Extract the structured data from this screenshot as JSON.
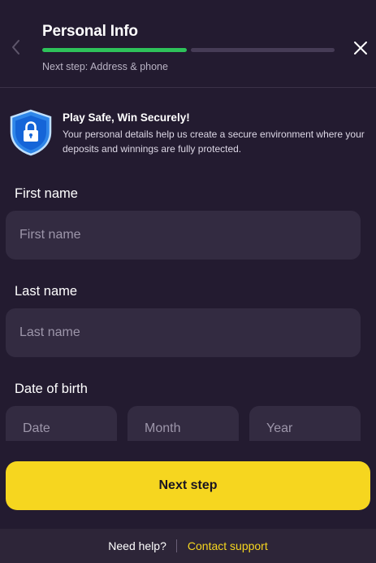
{
  "header": {
    "title": "Personal Info",
    "next_step_text": "Next step: Address & phone",
    "progress": {
      "steps_total": 2,
      "steps_completed": 1
    },
    "colors": {
      "progress_done": "#2ec25a",
      "progress_pending": "#463c56"
    }
  },
  "safety_notice": {
    "title": "Play Safe, Win Securely!",
    "description": "Your personal details help us create a secure environment where your deposits and winnings are fully protected.",
    "icon": "shield-lock-icon"
  },
  "form": {
    "first_name": {
      "label": "First name",
      "placeholder": "First name",
      "value": ""
    },
    "last_name": {
      "label": "Last name",
      "placeholder": "Last name",
      "value": ""
    },
    "dob": {
      "label": "Date of birth",
      "date_placeholder": "Date",
      "month_placeholder": "Month",
      "year_placeholder": "Year"
    }
  },
  "actions": {
    "next_step_label": "Next step",
    "accent_color": "#f6d61f"
  },
  "help": {
    "text": "Need help?",
    "link_label": "Contact support"
  }
}
